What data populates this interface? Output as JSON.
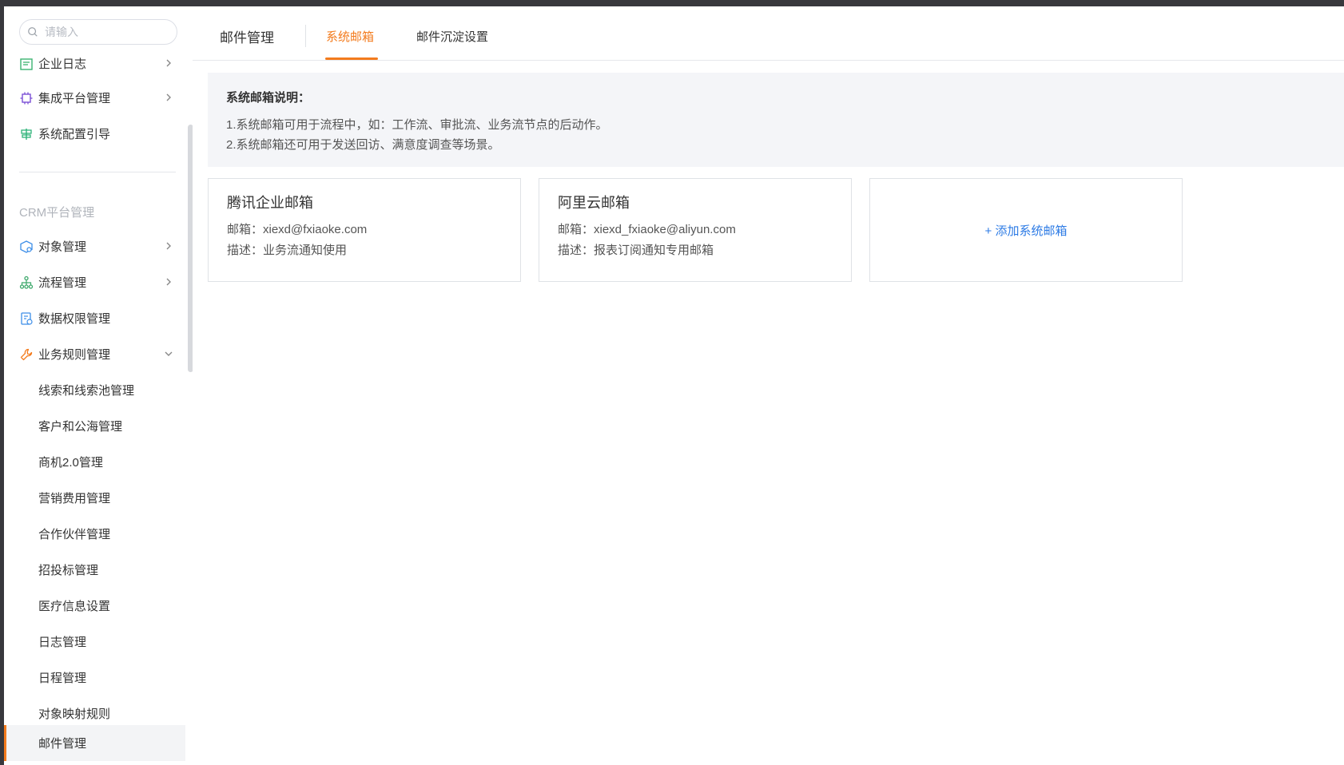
{
  "sidebar": {
    "search_placeholder": "请输入",
    "items_top": [
      {
        "label": "企业日志",
        "icon": "log-icon"
      },
      {
        "label": "集成平台管理",
        "icon": "chip-icon"
      },
      {
        "label": "系统配置引导",
        "icon": "signpost-icon"
      }
    ],
    "group_label": "CRM平台管理",
    "items_crm": [
      {
        "label": "对象管理",
        "icon": "cube-icon"
      },
      {
        "label": "流程管理",
        "icon": "flow-icon"
      },
      {
        "label": "数据权限管理",
        "icon": "data-permission-icon"
      },
      {
        "label": "业务规则管理",
        "icon": "wrench-icon"
      }
    ],
    "sub_items": [
      "线索和线索池管理",
      "客户和公海管理",
      "商机2.0管理",
      "营销费用管理",
      "合作伙伴管理",
      "招投标管理",
      "医疗信息设置",
      "日志管理",
      "日程管理",
      "对象映射规则",
      "邮件管理"
    ]
  },
  "tabs": [
    "邮件管理",
    "系统邮箱",
    "邮件沉淀设置"
  ],
  "active_tab": "系统邮箱",
  "notice": {
    "title": "系统邮箱说明：",
    "line1": "1.系统邮箱可用于流程中，如：工作流、审批流、业务流节点的后动作。",
    "line2": "2.系统邮箱还可用于发送回访、满意度调查等场景。"
  },
  "mailboxes": [
    {
      "name": "腾讯企业邮箱",
      "email": "邮箱：xiexd@fxiaoke.com",
      "desc": "描述：业务流通知使用"
    },
    {
      "name": "阿里云邮箱",
      "email": "邮箱：xiexd_fxiaoke@aliyun.com",
      "desc": "描述：报表订阅通知专用邮箱"
    }
  ],
  "add_mailbox_label": "+ 添加系统邮箱",
  "colors": {
    "accent": "#f37b1d",
    "link": "#2d7be5",
    "frame": "#38383d"
  }
}
